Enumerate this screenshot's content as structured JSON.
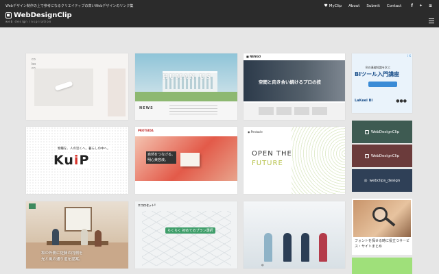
{
  "header": {
    "tagline": "Webデザイン制作の上で参考になるクリエイティブの高いWebデザインのリンク集",
    "logo_text": "WebDesignClip",
    "logo_sub": "web design inspiration",
    "nav": [
      {
        "label": "MyClip",
        "icon": "heart-icon"
      },
      {
        "label": "About"
      },
      {
        "label": "Submit"
      },
      {
        "label": "Contact"
      }
    ],
    "social": [
      "facebook-icon",
      "twitter-icon",
      "rss-icon"
    ]
  },
  "cards": {
    "c2_headline": "HUMAN US",
    "c2_news": "NEWS",
    "c3_copy": "空間と向き合い続けるプロの技",
    "c4_small": "物種を、人の近くへ。暮らしの中へ。",
    "c4_big_a": "Ku",
    "c4_big_b": "i",
    "c4_big_c": "P",
    "c5_logo": "PROTEIDA",
    "c5_copy_1": "自然をつなげる。",
    "c5_copy_2": "明心美容液。",
    "c6_big_1": "OPEN THE",
    "c6_big_2": "FUTURE",
    "c7_copy_1": "和の外側に佐藤の内側を",
    "c7_copy_2": "光と風の通り道を提案。",
    "c8_logo": "エコロセット!",
    "c8_pill": "らくらく 初めてのプラン選択"
  },
  "ad": {
    "tag": "i X",
    "small": "BIの基礎知識を学ぶ",
    "title": "BIツール入門講座",
    "logo": "LaKeel BI"
  },
  "banners": [
    {
      "label": "WebDesignClip"
    },
    {
      "label": "WebDesignClip"
    },
    {
      "label": "webclips_design"
    }
  ],
  "article": {
    "caption": "フォントを探せる時に役立つサービス・サイトまとめ"
  }
}
